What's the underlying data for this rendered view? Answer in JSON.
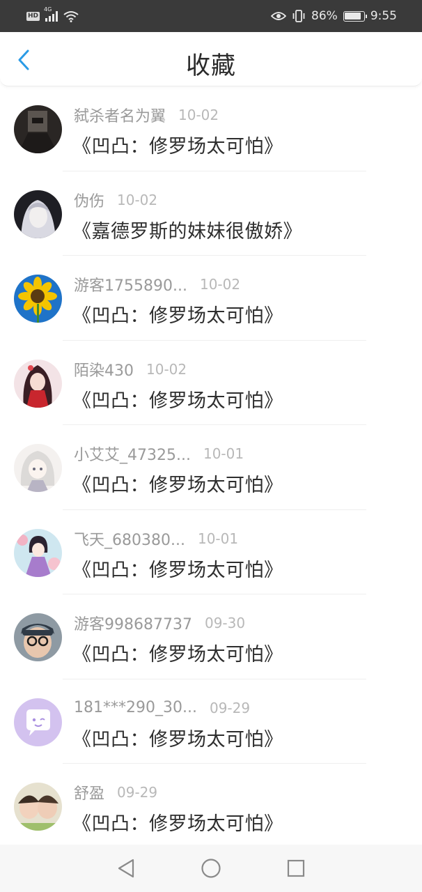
{
  "status_bar": {
    "badge": "HD",
    "network": "4G",
    "battery_percent": "86%",
    "battery_level": 0.86,
    "time": "9:55",
    "icons": [
      "eye-icon",
      "vibrate-icon",
      "wifi-icon",
      "signal-icon",
      "battery-icon"
    ]
  },
  "header": {
    "title": "收藏",
    "back_icon": "chevron-left-icon",
    "accent_color": "#2a9be6"
  },
  "items": [
    {
      "user": "弑杀者名为翼",
      "date": "10-02",
      "title": "《凹凸：修罗场太可怕》"
    },
    {
      "user": "伪伤",
      "date": "10-02",
      "title": "《嘉德罗斯的妹妹很傲娇》"
    },
    {
      "user": "游客1755890...",
      "date": "10-02",
      "title": "《凹凸：修罗场太可怕》"
    },
    {
      "user": "陌染430",
      "date": "10-02",
      "title": "《凹凸：修罗场太可怕》"
    },
    {
      "user": "小艾艾_47325...",
      "date": "10-01",
      "title": "《凹凸：修罗场太可怕》"
    },
    {
      "user": "飞天_680380...",
      "date": "10-01",
      "title": "《凹凸：修罗场太可怕》"
    },
    {
      "user": "游客998687737",
      "date": "09-30",
      "title": "《凹凸：修罗场太可怕》"
    },
    {
      "user": "181***290_30...",
      "date": "09-29",
      "title": "《凹凸：修罗场太可怕》"
    },
    {
      "user": "舒盈",
      "date": "09-29",
      "title": "《凹凸：修罗场太可怕》"
    }
  ],
  "nav_bar": {
    "icons": [
      "back-triangle-icon",
      "home-circle-icon",
      "recents-square-icon"
    ]
  }
}
